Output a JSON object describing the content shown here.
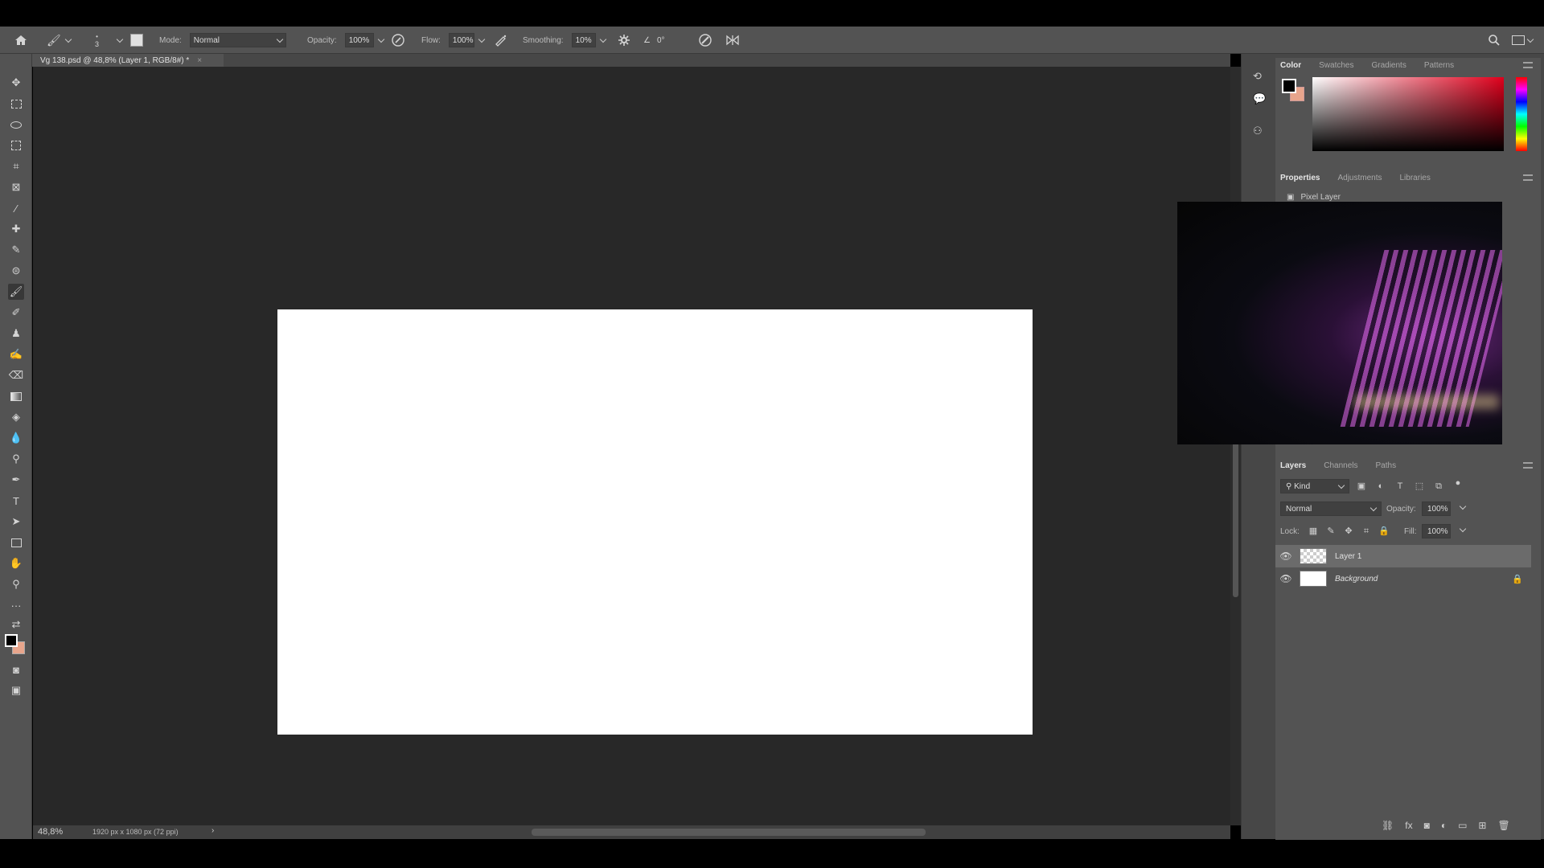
{
  "options": {
    "mode_label": "Mode:",
    "mode_value": "Normal",
    "brush_size": "3",
    "opacity_label": "Opacity:",
    "opacity_value": "100%",
    "flow_label": "Flow:",
    "flow_value": "100%",
    "smoothing_label": "Smoothing:",
    "smoothing_value": "10%",
    "angle_value": "0°"
  },
  "document": {
    "tab_title": "Vg 138.psd @ 48,8% (Layer 1, RGB/8#) *",
    "close_glyph": "×"
  },
  "status": {
    "zoom": "48,8%",
    "doc_info": "1920 px x 1080 px (72 ppi)"
  },
  "color_panel": {
    "tabs": [
      "Color",
      "Swatches",
      "Gradients",
      "Patterns"
    ],
    "foreground": "#000000",
    "background": "#e8a58c"
  },
  "properties_panel": {
    "tabs": [
      "Properties",
      "Adjustments",
      "Libraries"
    ],
    "layer_type": "Pixel Layer"
  },
  "layers_panel": {
    "tabs": [
      "Layers",
      "Channels",
      "Paths"
    ],
    "filter_kind": "Kind",
    "blend_mode": "Normal",
    "opacity_label": "Opacity:",
    "opacity_value": "100%",
    "lock_label": "Lock:",
    "fill_label": "Fill:",
    "fill_value": "100%",
    "layers": [
      {
        "name": "Layer 1"
      },
      {
        "name": "Background"
      }
    ]
  },
  "icons": [
    "home-icon",
    "brush-icon",
    "brush-settings-icon",
    "airbrush-icon",
    "settings-gear-icon",
    "angle-icon",
    "pressure-icon",
    "symmetry-icon",
    "search-icon",
    "workspace-icon",
    "move-icon",
    "marquee-icon",
    "lasso-icon",
    "object-select-icon",
    "crop-icon",
    "frame-icon",
    "eyedropper-icon",
    "healing-icon",
    "brush-tool-icon",
    "clone-stamp-icon",
    "history-brush-icon",
    "eraser-icon",
    "gradient-icon",
    "blur-icon",
    "dodge-icon",
    "pen-icon",
    "type-icon",
    "path-select-icon",
    "rectangle-icon",
    "hand-icon",
    "zoom-icon",
    "eye-icon",
    "lock-icon"
  ]
}
